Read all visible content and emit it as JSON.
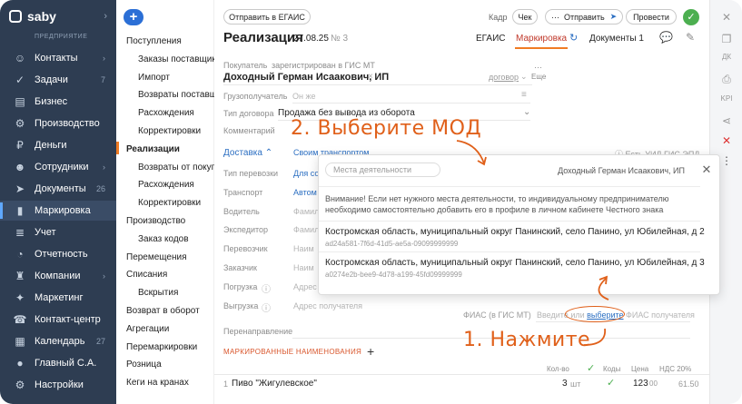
{
  "nav": {
    "logo": "saby",
    "section": "ПРЕДПРИЯТИЕ",
    "items": [
      {
        "label": "Контакты",
        "count": ""
      },
      {
        "label": "Задачи",
        "count": "7"
      },
      {
        "label": "Бизнес",
        "count": ""
      },
      {
        "label": "Производство",
        "count": ""
      },
      {
        "label": "Деньги",
        "count": ""
      },
      {
        "label": "Сотрудники",
        "count": ""
      },
      {
        "label": "Документы",
        "count": "26"
      },
      {
        "label": "Маркировка",
        "count": ""
      },
      {
        "label": "Учет",
        "count": ""
      },
      {
        "label": "Отчетность",
        "count": ""
      },
      {
        "label": "Компании",
        "count": ""
      },
      {
        "label": "Маркетинг",
        "count": ""
      },
      {
        "label": "Контакт-центр",
        "count": ""
      },
      {
        "label": "Календарь",
        "count": "27"
      },
      {
        "label": "Главный С.А.",
        "count": ""
      },
      {
        "label": "Настройки",
        "count": ""
      }
    ]
  },
  "submenu": [
    "Поступления",
    "Заказы поставщикам",
    "Импорт",
    "Возвраты поставщикам",
    "Расхождения",
    "Корректировки",
    "Реализации",
    "Возвраты от покупателей",
    "Расхождения",
    "Корректировки",
    "Производство",
    "Заказ кодов",
    "Перемещения",
    "Списания",
    "Вскрытия",
    "Возврат в оборот",
    "Агрегации",
    "Перемаркировки",
    "Розница",
    "Кеги на кранах"
  ],
  "toolbar": {
    "send_egais": "Отправить в ЕГАИС",
    "kadr": "Кадр",
    "check": "Чек",
    "send": "Отправить",
    "post": "Провести"
  },
  "doc": {
    "title": "Реализация",
    "date": "27.08.25",
    "number": "№ 3",
    "tabs": [
      "ЕГАИС",
      "Маркировка",
      "Документы"
    ],
    "docs_count": "1"
  },
  "form": {
    "buyer_label": "Покупатель",
    "buyer_status": "зарегистрирован в ГИС МТ",
    "buyer_name": "Доходный Герман Исаакович, ИП",
    "contract": "договор",
    "more": "Еще",
    "consignee_label": "Грузополучатель",
    "consignee_ph": "Он же",
    "contract_type_label": "Тип договора",
    "contract_type": "Продажа без вывода из оборота",
    "comment_label": "Комментарий",
    "delivery": "Доставка",
    "own_transport": "Своим транспортом",
    "uid": "Есть УИД ГИС ЭПД",
    "labels": [
      "Тип перевозки",
      "Транспорт",
      "Водитель",
      "Экспедитор",
      "Перевозчик",
      "Заказчик",
      "Погрузка",
      "Выгрузка"
    ],
    "values": [
      "Для со",
      "Автом",
      "Фамил",
      "Фамил",
      "Наим",
      "Наим",
      "Адрес",
      "Адрес получателя"
    ],
    "fias_label": "ФИАС (в ГИС МТ)",
    "fias_enter": "Введите",
    "fias_or": "или",
    "fias_choose": "выберите",
    "fias_receiver": "ФИАС получателя",
    "readdress": "Перенаправление",
    "marked_section": "МАРКИРОВАННЫЕ НАИМЕНОВАНИЯ"
  },
  "table": {
    "headers": [
      "Кол-во",
      "Коды",
      "Цена",
      "НДС 20%"
    ],
    "row": {
      "num": "1",
      "name": "Пиво \"Жигулевское\"",
      "qty": "3",
      "unit": "шт",
      "price": "123",
      "kop": "00",
      "vat": "61.50"
    }
  },
  "popup": {
    "search_ph": "Места деятельности",
    "owner": "Доходный Герман Исаакович, ИП",
    "notice": "Внимание! Если нет нужного места деятельности, то индивидуальному предпринимателю необходимо самостоятельно добавить его в профиле в личном кабинете Честного знака",
    "addresses": [
      {
        "text": "Костромская область, муниципальный округ Панинский, село Панино, ул Юбилейная, д 2",
        "code": "ad24a581-7f6d-41d5-ae5a-09099999999"
      },
      {
        "text": "Костромская область, муниципальный округ Панинский, село Панино, ул Юбилейная, д 3",
        "code": "a0274e2b-bee9-4d78-a199-45fd09999999"
      }
    ]
  },
  "annotations": {
    "step1": "1. Нажмите",
    "step2": "2. Выберите МОД"
  },
  "colors": {
    "nav_bg": "#2e3d52",
    "accent": "#f07b23",
    "link": "#2c6fc2",
    "annot": "#e0601a",
    "ok": "#4caf50"
  }
}
